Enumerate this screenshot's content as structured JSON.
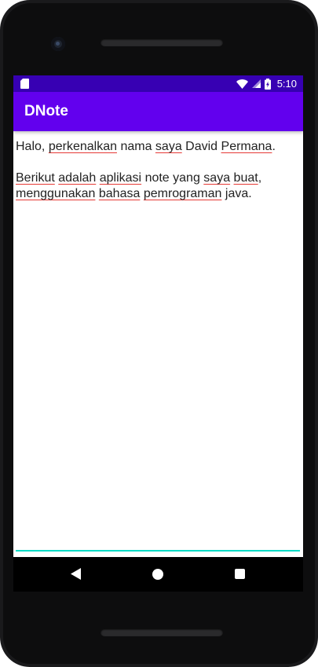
{
  "status_bar": {
    "time": "5:10",
    "icons": [
      "sd-card-icon",
      "wifi-icon",
      "signal-icon",
      "battery-charging-icon"
    ],
    "color": "#3700b3"
  },
  "app_bar": {
    "title": "DNote",
    "color": "#6200ee"
  },
  "note": {
    "paragraph1": {
      "w1": "Halo,",
      "w2": "perkenalkan",
      "w3": "nama",
      "w4": "saya",
      "w5": "David",
      "w6": "Permana",
      "w7": "."
    },
    "paragraph2": {
      "w1": "Berikut",
      "w2": "adalah",
      "w3": "aplikasi",
      "w4": "note yang",
      "w5": "saya",
      "w6": "buat",
      "w7": ",",
      "w8": "menggunakan",
      "w9": "bahasa",
      "w10": "pemrograman",
      "w11": "java."
    },
    "cursor_color": "#03dac5",
    "spellcheck_color": "#e53935"
  },
  "nav_bar": {
    "buttons": [
      "back-icon",
      "home-icon",
      "recents-icon"
    ]
  }
}
